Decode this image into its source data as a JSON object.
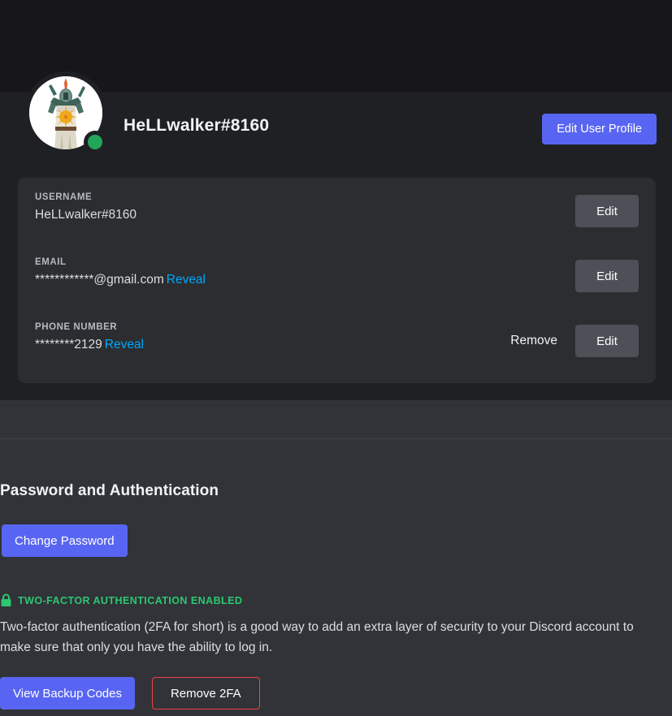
{
  "profile": {
    "display_name": "HeLLwalker#8160",
    "status": "online",
    "status_color": "#23a55a",
    "avatar_alt": "solaire-knight-avatar",
    "edit_profile_label": "Edit User Profile"
  },
  "account_fields": [
    {
      "label": "USERNAME",
      "value": "HeLLwalker#8160",
      "reveal_label": "",
      "remove_label": "",
      "edit_label": "Edit"
    },
    {
      "label": "EMAIL",
      "value": "************@gmail.com",
      "reveal_label": "Reveal",
      "remove_label": "",
      "edit_label": "Edit"
    },
    {
      "label": "PHONE NUMBER",
      "value": "********2129",
      "reveal_label": "Reveal",
      "remove_label": "Remove",
      "edit_label": "Edit"
    }
  ],
  "password_section": {
    "title": "Password and Authentication",
    "change_password_label": "Change Password",
    "mfa_status_label": "TWO-FACTOR AUTHENTICATION ENABLED",
    "mfa_status_color": "#2dc770",
    "mfa_description": "Two-factor authentication (2FA for short) is a good way to add an extra layer of security to your Discord account to make sure that only you have the ability to log in.",
    "backup_codes_label": "View Backup Codes",
    "remove_2fa_label": "Remove 2FA"
  },
  "colors": {
    "accent": "#5865f2",
    "danger": "#ed4245",
    "link": "#00a8fc",
    "card_bg": "#2b2d31",
    "banner_bg": "#171719"
  }
}
